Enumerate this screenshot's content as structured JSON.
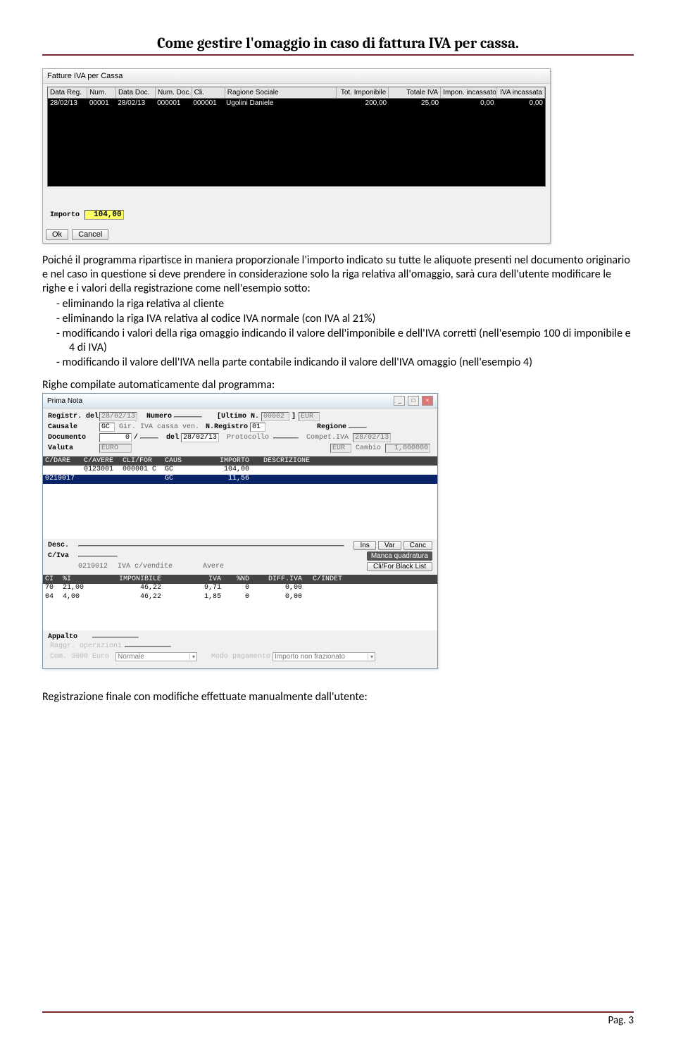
{
  "doc": {
    "header_title": "Come gestire l'omaggio in caso di fattura IVA per cassa.",
    "footer": "Pag. 3"
  },
  "win1": {
    "title": "Fatture IVA per Cassa",
    "columns": [
      "Data Reg.",
      "Num.",
      "Data Doc.",
      "Num. Doc.",
      "Cli.",
      "Ragione Sociale",
      "Tot. Imponibile",
      "Totale IVA",
      "Impon. incassato",
      "IVA incassata"
    ],
    "row": {
      "data_reg": "28/02/13",
      "num": "00001",
      "data_doc": "28/02/13",
      "num_doc": "000001",
      "cli": "000001",
      "rag": "Ugolini Daniele",
      "tot_imp": "200,00",
      "tot_iva": "25,00",
      "imp_inc": "0,00",
      "iva_inc": "0,00"
    },
    "importo_label": "Importo",
    "importo_value": "104,00",
    "ok": "Ok",
    "cancel": "Cancel"
  },
  "para": {
    "intro": "Poiché il programma ripartisce in maniera proporzionale l'importo indicato su tutte le aliquote presenti nel documento originario e nel caso in questione si deve prendere in considerazione solo la riga relativa all'omaggio, sarà cura dell'utente modificare le righe e i valori della registrazione come nell'esempio sotto:",
    "b1": "eliminando la riga relativa al cliente",
    "b2": "eliminando la riga IVA relativa al codice IVA normale (con IVA al 21%)",
    "b3": "modificando i valori della riga omaggio  indicando il valore dell'imponibile e dell'IVA corretti (nell'esempio 100 di imponibile e 4 di IVA)",
    "b4": "modificando il valore dell'IVA nella parte contabile indicando il valore dell'IVA omaggio (nell'esempio 4)",
    "sub": "Righe compilate automaticamente dal programma:",
    "final": "Registrazione finale con modifiche effettuate manualmente dall'utente:"
  },
  "win2": {
    "title": "Prima Nota",
    "labels": {
      "registr_del": "Registr. del",
      "numero": "Numero",
      "ultimo_n": "[Ultimo N.",
      "causale": "Causale",
      "nregistro": "N.Registro",
      "regione": "Regione",
      "documento": "Documento",
      "del": "del",
      "protocollo": "Protocollo",
      "compet_iva": "Compet.IVA",
      "valuta": "Valuta",
      "cambio": "Cambio",
      "desc": "Desc.",
      "civa": "C/Iva",
      "appalto": "Appalto",
      "raggr": "Raggr. operazioni",
      "com3000": "Com. 3000 Euro",
      "modo_pag": "Modo pagamento"
    },
    "vals": {
      "registr_del": "28/02/13",
      "ultimo_n": "00002",
      "eur": "EUR",
      "causale_code": "GC",
      "causale_desc": "Gir. IVA cassa ven.",
      "nregistro": "01",
      "documento": "0",
      "doc_sep": "/",
      "del": "28/02/13",
      "compet_iva": "28/02/13",
      "valuta": "EURO",
      "valuta2": "EUR",
      "cambio": "1,000000",
      "civa_code": "0219012",
      "civa_desc": "IVA c/vendite",
      "civa_side": "Avere",
      "com3000_opt": "Normale",
      "modo_pag_opt": "Importo non frazionato"
    },
    "grid_head": {
      "cdare": "C/DARE",
      "cavere": "C/AVERE",
      "clifor": "CLI/FOR",
      "caus": "CAUS",
      "importo": "IMPORTO",
      "descr": "DESCRIZIONE"
    },
    "grid_rows": [
      {
        "cdare": "",
        "cavere": "0123001",
        "clifor": "000001 C",
        "caus": "GC",
        "importo": "104,00",
        "descr": ""
      },
      {
        "cdare": "0219017",
        "cavere": "",
        "clifor": "",
        "caus": "GC",
        "importo": "11,56",
        "descr": ""
      }
    ],
    "btns": {
      "ins": "Ins",
      "var": "Var",
      "canc": "Canc"
    },
    "warn": "Manca quadratura",
    "blacklist": "Cli/For Black List",
    "iva_head": {
      "ci": "CI",
      "pi": "%I",
      "imp": "IMPONIBILE",
      "iva": "IVA",
      "nd": "%ND",
      "dif": "DIFF.IVA",
      "ind": "C/INDET"
    },
    "iva_rows": [
      {
        "ci": "70",
        "pi": "21,00",
        "imp": "46,22",
        "iva": "9,71",
        "nd": "0",
        "dif": "0,00",
        "ind": ""
      },
      {
        "ci": "04",
        "pi": "4,00",
        "imp": "46,22",
        "iva": "1,85",
        "nd": "0",
        "dif": "0,00",
        "ind": ""
      }
    ]
  }
}
